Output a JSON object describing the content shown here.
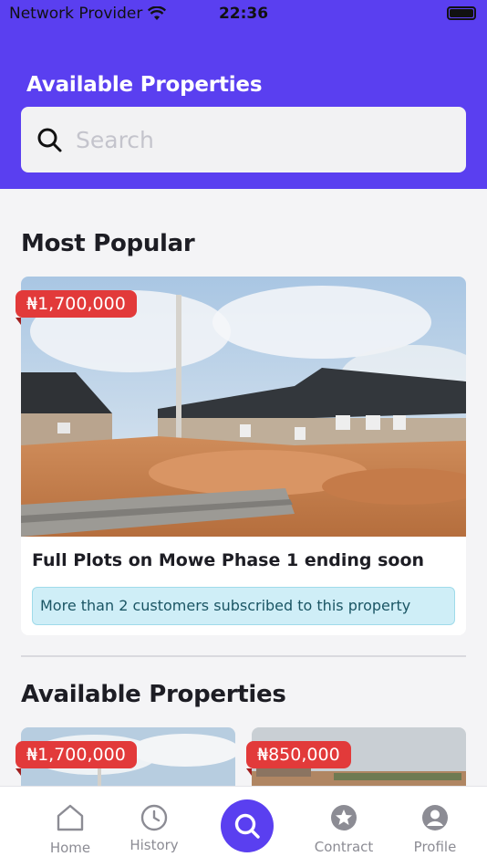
{
  "status": {
    "carrier": "Network Provider",
    "time": "22:36"
  },
  "header": {
    "title": "Available Properties"
  },
  "search": {
    "placeholder": "Search"
  },
  "most_popular": {
    "title": "Most Popular",
    "card": {
      "price": "₦1,700,000",
      "title": "Full Plots on Mowe Phase 1 ending soon",
      "subscribers": "More than 2 customers subscribed to this property"
    }
  },
  "available": {
    "title": "Available Properties",
    "items": [
      {
        "price": "₦1,700,000"
      },
      {
        "price": "₦850,000"
      }
    ]
  },
  "tabs": [
    {
      "label": "Home",
      "icon": "home-icon"
    },
    {
      "label": "History",
      "icon": "clock-icon"
    },
    {
      "label": "",
      "icon": "search-icon"
    },
    {
      "label": "Contract",
      "icon": "star-icon"
    },
    {
      "label": "Profile",
      "icon": "user-icon"
    }
  ],
  "colors": {
    "primary": "#5a3ff0",
    "price_tag": "#e23a3a",
    "info_bg": "#cfeef7"
  }
}
